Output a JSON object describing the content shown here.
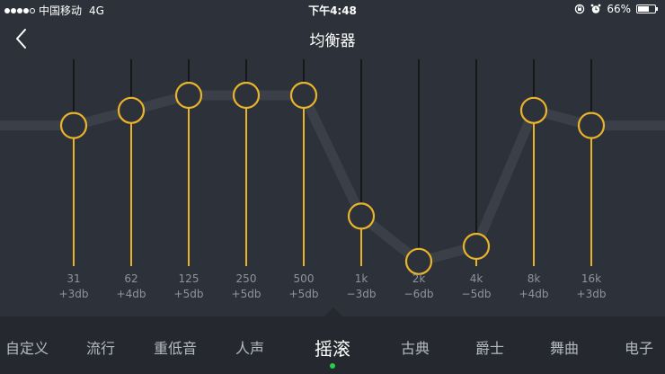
{
  "status_bar": {
    "carrier": "中国移动",
    "network": "4G",
    "time": "下午4:48",
    "battery_text": "66%",
    "battery_level": 0.66,
    "signal_bars_filled": 4,
    "signal_bars_total": 5
  },
  "nav": {
    "title": "均衡器",
    "back_icon": "chevron-left-icon"
  },
  "equalizer": {
    "bands": [
      {
        "freq": "31",
        "gain_label": "+3db",
        "gain": 3
      },
      {
        "freq": "62",
        "gain_label": "+4db",
        "gain": 4
      },
      {
        "freq": "125",
        "gain_label": "+5db",
        "gain": 5
      },
      {
        "freq": "250",
        "gain_label": "+5db",
        "gain": 5
      },
      {
        "freq": "500",
        "gain_label": "+5db",
        "gain": 5
      },
      {
        "freq": "1k",
        "gain_label": "−3db",
        "gain": -3
      },
      {
        "freq": "2k",
        "gain_label": "−6db",
        "gain": -6
      },
      {
        "freq": "4k",
        "gain_label": "−5db",
        "gain": -5
      },
      {
        "freq": "8k",
        "gain_label": "+4db",
        "gain": 4
      },
      {
        "freq": "16k",
        "gain_label": "+3db",
        "gain": 3
      }
    ],
    "gain_range": [
      -12,
      12
    ],
    "colors": {
      "accent": "#e9b32a",
      "track_upper": "#15171b",
      "curve": "#3b4048",
      "knob_fill": "#2d323a"
    }
  },
  "presets": {
    "items": [
      "自定义",
      "流行",
      "重低音",
      "人声",
      "摇滚",
      "古典",
      "爵士",
      "舞曲",
      "电子"
    ],
    "selected": "摇滚",
    "selected_index": 4,
    "indicator_color": "#21d14a"
  }
}
